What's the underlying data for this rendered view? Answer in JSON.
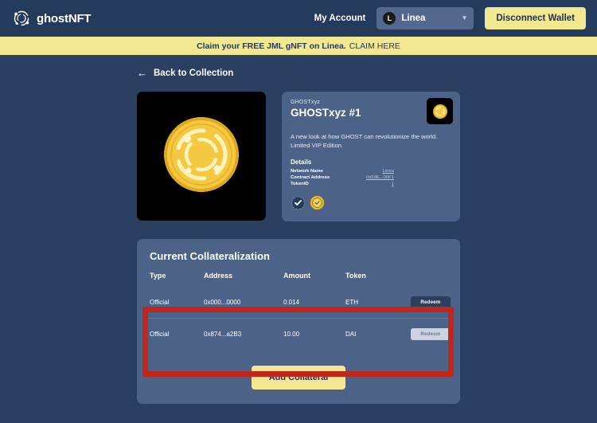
{
  "header": {
    "brand_name": "ghostNFT",
    "brand_icon": "ghost-ring-logo-icon",
    "my_account_label": "My Account",
    "network": {
      "label": "Linea",
      "icon": "linea-token-icon",
      "icon_glyph": "L",
      "chevron_icon": "chevron-down-icon"
    },
    "disconnect_label": "Disconnect Wallet"
  },
  "banner": {
    "text": "Claim your FREE JML gNFT on Linea.",
    "link_label": "CLAIM HERE"
  },
  "back_link": {
    "label": "Back to Collection",
    "icon": "arrow-left-icon",
    "arrow": "←"
  },
  "nft": {
    "art_icon": "gold-coin-pixel-art",
    "collection_name": "GHOSTxyz",
    "title": "GHOSTxyz #1",
    "description": "A new look at how GHOST can revolutionize the world. Limited VIP Edition.",
    "details_heading": "Details",
    "details": [
      {
        "label": "Network Name",
        "value": "Linea"
      },
      {
        "label": "Contract Address",
        "value": "0x59E...00F1"
      },
      {
        "label": "TokenID",
        "value": "1"
      }
    ],
    "badges": [
      {
        "name": "verified-check-badge-icon",
        "glyph": "✓"
      },
      {
        "name": "gold-seal-badge-icon",
        "glyph": "✓"
      }
    ]
  },
  "collateral": {
    "title": "Current Collateralization",
    "columns": [
      "Type",
      "Address",
      "Amount",
      "Token",
      ""
    ],
    "rows": [
      {
        "type": "Official",
        "address": "0x000...0000",
        "amount": "0.014",
        "token": "ETH",
        "action_label": "Redeem",
        "action_state": "active"
      },
      {
        "type": "Official",
        "address": "0x874...a2B3",
        "amount": "10.00",
        "token": "DAI",
        "action_label": "Redeem",
        "action_state": "disabled"
      }
    ],
    "add_button_label": "Add Collateral"
  },
  "colors": {
    "page_background": "#2b4061",
    "header_background": "#243a5c",
    "panel_background": "#4d6287",
    "accent_yellow": "#f2e891",
    "annotation_red": "#c0261c",
    "coin_gold": "#f5c842"
  }
}
